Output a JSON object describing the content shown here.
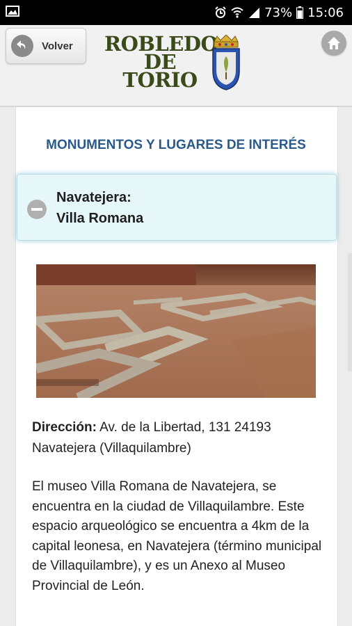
{
  "status_bar": {
    "battery": "73%",
    "time": "15:06",
    "icons": [
      "image-icon",
      "alarm-icon",
      "wifi-icon",
      "signal-icon",
      "battery-icon"
    ]
  },
  "header": {
    "back_label": "Volver",
    "logo_text": [
      "ROBLEDO",
      "DE",
      "TORIO"
    ]
  },
  "section_title": "MONUMENTOS Y LUGARES DE INTERÉS",
  "item": {
    "title_line1": "Navatejera:",
    "title_line2": "Villa Romana",
    "address_label": "Dirección:",
    "address_value": "Av. de la Libertad, 131 24193 Navatejera (Villaquilambre)",
    "description": "El museo Villa Romana de Navatejera, se encuentra en la ciudad de Villaquilambre. Este espacio arqueológico se encuentra a 4km de la capital leonesa, en Navatejera (término municipal de Villaquilambre), y es un Anexo al Museo Provincial de León."
  },
  "colors": {
    "title_blue": "#2a5a8c",
    "accordion_bg": "#e6f7fa",
    "status_bar": "#000000"
  }
}
